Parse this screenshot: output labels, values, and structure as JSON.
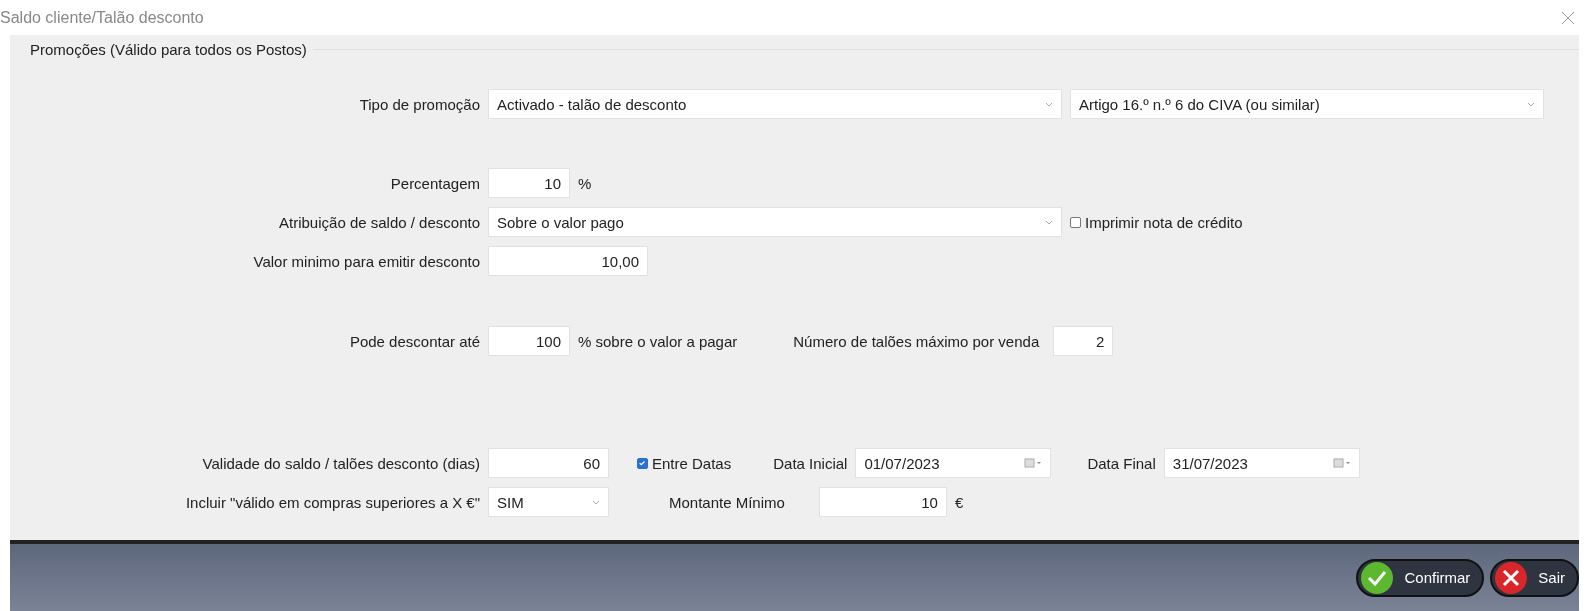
{
  "window": {
    "title": "Saldo cliente/Talão desconto"
  },
  "group": {
    "title": "Promoções (Válido para todos os Postos)"
  },
  "tipo_promocao": {
    "label": "Tipo de promoção",
    "value": "Activado - talão de desconto",
    "value_2": "Artigo 16.º n.º 6 do CIVA (ou similar)"
  },
  "percentagem": {
    "label": "Percentagem",
    "value": "10",
    "unit": "%"
  },
  "atribuicao": {
    "label": "Atribuição de saldo / desconto",
    "value": "Sobre o valor pago",
    "checkbox": {
      "label": "Imprimir nota de crédito",
      "checked": false
    }
  },
  "valor_minimo": {
    "label": "Valor minimo para emitir desconto",
    "value": "10,00"
  },
  "pode_descontar": {
    "label": "Pode descontar até",
    "value": "100",
    "unit": "% sobre o valor a pagar",
    "max_label": "Número de talões máximo por venda",
    "max_value": "2"
  },
  "validade": {
    "label": "Validade do saldo / talões desconto (dias)",
    "value": "60",
    "checkbox": {
      "label": "Entre Datas",
      "checked": true
    },
    "start_label": "Data Inicial",
    "start": "01/07/2023",
    "end_label": "Data Final",
    "end": "31/07/2023"
  },
  "incluir": {
    "label": "Incluir \"válido em compras superiores a X €\"",
    "value": "SIM",
    "amount_label": "Montante Mínimo",
    "amount": "10",
    "unit": "€"
  },
  "buttons": [
    {
      "label": "Confirmar",
      "kind": "confirm"
    },
    {
      "label": "Sair",
      "kind": "exit"
    }
  ]
}
